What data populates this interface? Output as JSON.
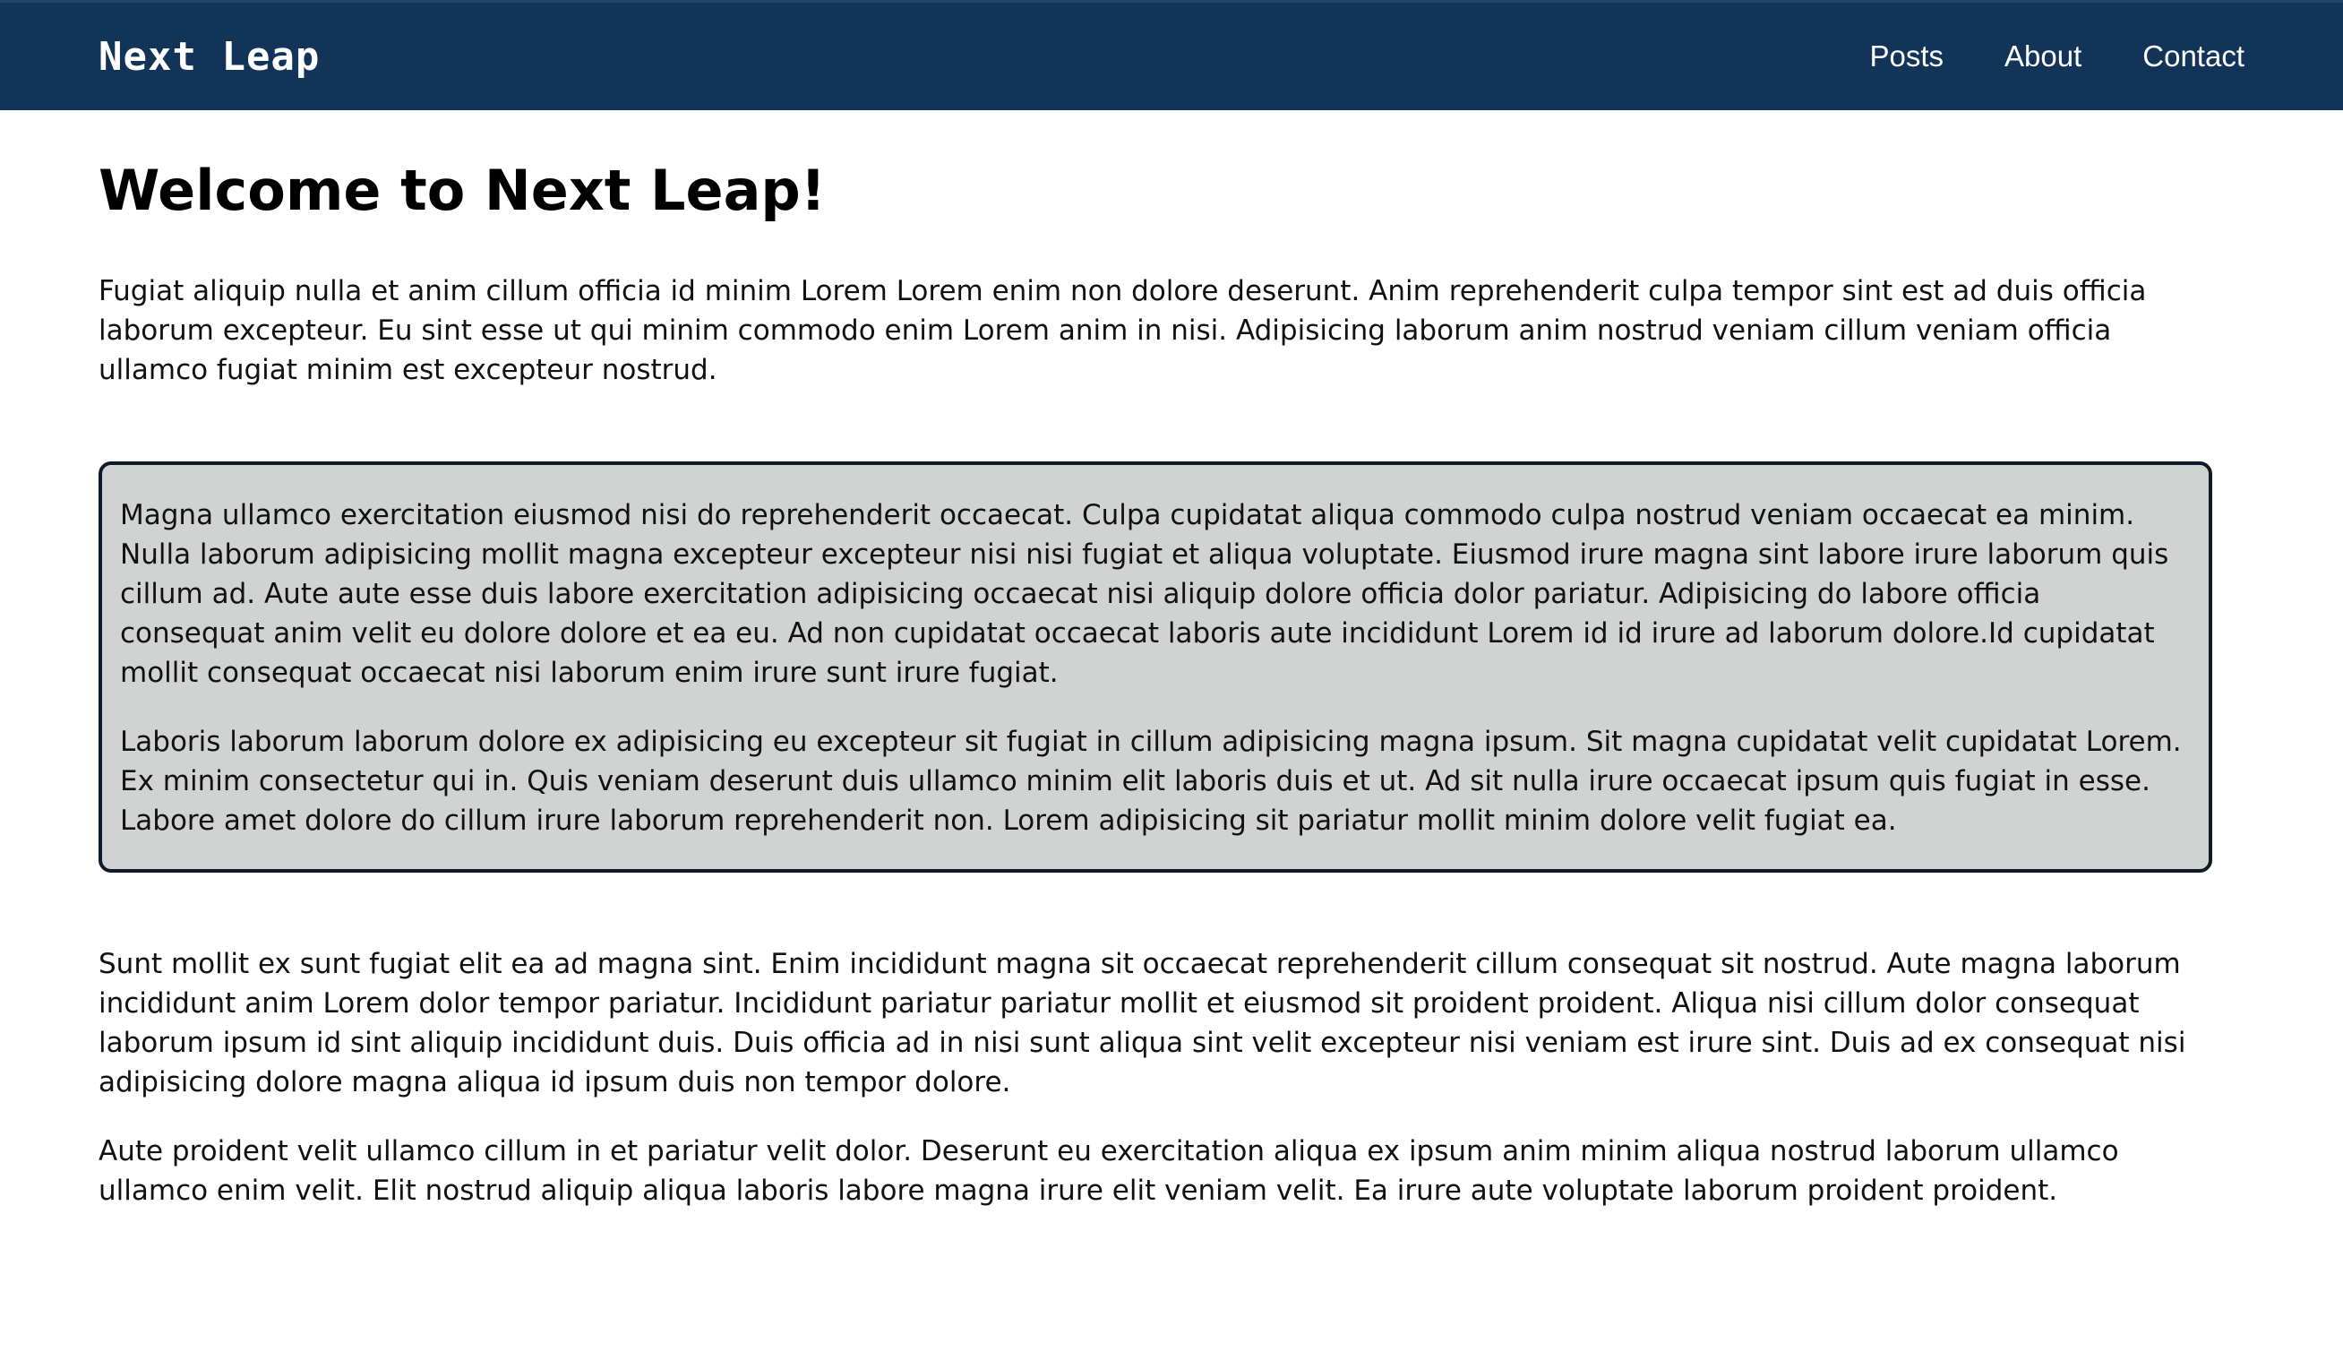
{
  "colors": {
    "navbar_bg": "#133459",
    "callout_bg": "#d1d3d2",
    "callout_border": "#0e1b2a"
  },
  "header": {
    "logo": "Next Leap",
    "nav": [
      "Posts",
      "About",
      "Contact"
    ]
  },
  "main": {
    "title": "Welcome to Next Leap!",
    "intro": "Fugiat aliquip nulla et anim cillum officia id minim Lorem Lorem enim non dolore deserunt. Anim reprehenderit culpa tempor sint est ad duis officia laborum excepteur. Eu sint esse ut qui minim commodo enim Lorem anim in nisi. Adipisicing laborum anim nostrud veniam cillum veniam officia ullamco fugiat minim est excepteur nostrud.",
    "callout": [
      "Magna ullamco exercitation eiusmod nisi do reprehenderit occaecat. Culpa cupidatat aliqua commodo culpa nostrud veniam occaecat ea minim. Nulla laborum adipisicing mollit magna excepteur excepteur nisi nisi fugiat et aliqua voluptate. Eiusmod irure magna sint labore irure laborum quis cillum ad. Aute aute esse duis labore exercitation adipisicing occaecat nisi aliquip dolore officia dolor pariatur. Adipisicing do labore officia consequat anim velit eu dolore dolore et ea eu. Ad non cupidatat occaecat laboris aute incididunt Lorem id id irure ad laborum dolore.Id cupidatat mollit consequat occaecat nisi laborum enim irure sunt irure fugiat.",
      "Laboris laborum laborum dolore ex adipisicing eu excepteur sit fugiat in cillum adipisicing magna ipsum. Sit magna cupidatat velit cupidatat Lorem. Ex minim consectetur qui in. Quis veniam deserunt duis ullamco minim elit laboris duis et ut. Ad sit nulla irure occaecat ipsum quis fugiat in esse. Labore amet dolore do cillum irure laborum reprehenderit non. Lorem adipisicing sit pariatur mollit minim dolore velit fugiat ea."
    ],
    "body": [
      "Sunt mollit ex sunt fugiat elit ea ad magna sint. Enim incididunt magna sit occaecat reprehenderit cillum consequat sit nostrud. Aute magna laborum incididunt anim Lorem dolor tempor pariatur. Incididunt pariatur pariatur mollit et eiusmod sit proident proident. Aliqua nisi cillum dolor consequat laborum ipsum id sint aliquip incididunt duis. Duis officia ad in nisi sunt aliqua sint velit excepteur nisi veniam est irure sint. Duis ad ex consequat nisi adipisicing dolore magna aliqua id ipsum duis non tempor dolore.",
      "Aute proident velit ullamco cillum in et pariatur velit dolor. Deserunt eu exercitation aliqua ex ipsum anim minim aliqua nostrud laborum ullamco ullamco enim velit. Elit nostrud aliquip aliqua laboris labore magna irure elit veniam velit. Ea irure aute voluptate laborum proident proident."
    ]
  }
}
